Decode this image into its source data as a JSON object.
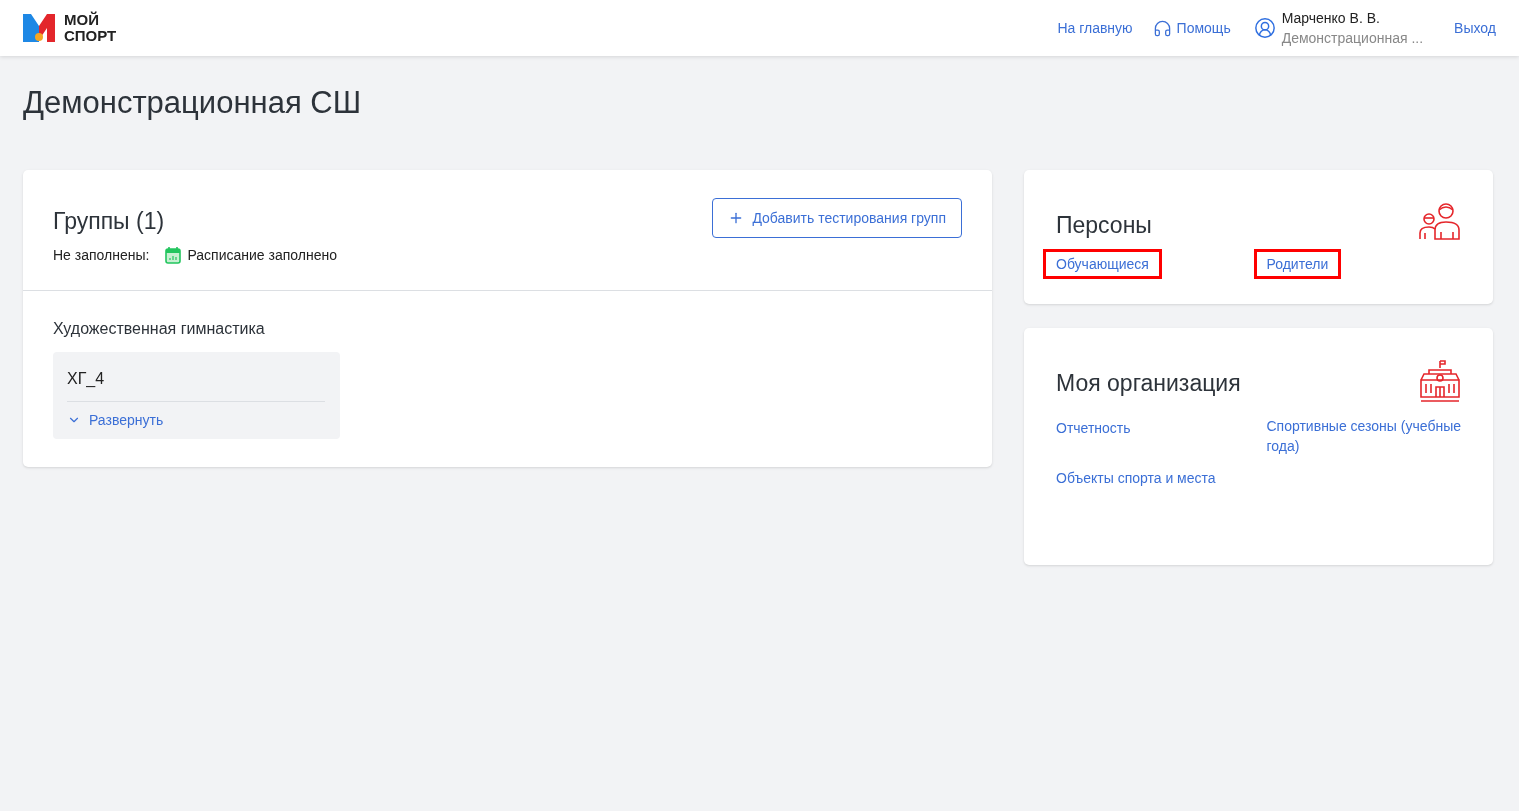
{
  "header": {
    "logo_text": [
      "МОЙ",
      "СПОРТ"
    ],
    "nav": [
      {
        "kind": "link",
        "label": "На главную"
      },
      {
        "kind": "help",
        "label": "Помощь"
      }
    ],
    "user": {
      "name": "Марченко В. В.",
      "organization": "Демонстрационная ..."
    },
    "logout": "Выход"
  },
  "page_title": "Демонстрационная СШ",
  "groups": {
    "title": "Группы (1)",
    "add_button": "Добавить тестирования групп",
    "unfilled_label": "Не заполнены:",
    "unfilled_items": [
      "Расписание заполнено"
    ],
    "sports": [
      {
        "name": "Художественная гимнастика",
        "groups": [
          {
            "name": "ХГ_4",
            "toggle": "Развернуть",
            "expanded": false
          }
        ]
      }
    ]
  },
  "cards": [
    {
      "kind": "persons",
      "title": "Персоны",
      "links": [
        {
          "label": "Обучающиеся",
          "highlighted": true
        },
        {
          "label": "Родители",
          "highlighted": true
        }
      ]
    },
    {
      "kind": "organization",
      "title": "Моя организация",
      "links": [
        {
          "label": "Отчетность",
          "highlighted": false
        },
        {
          "label": "Спортивные сезоны (учебные года)",
          "highlighted": false
        },
        {
          "label": "Объекты спорта и места",
          "highlighted": false
        }
      ]
    }
  ]
}
